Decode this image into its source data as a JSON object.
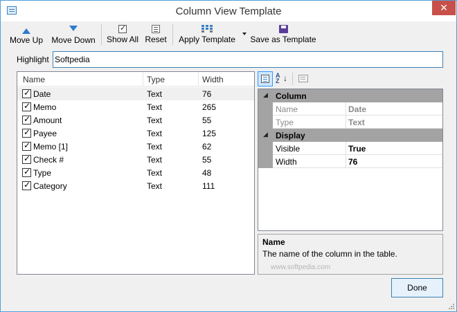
{
  "window": {
    "title": "Column View Template",
    "close_glyph": "✕"
  },
  "toolbar": {
    "move_up_label": "Move Up",
    "move_down_label": "Move Down",
    "show_all_label": "Show All",
    "reset_label": "Reset",
    "apply_template_label": "Apply Template",
    "save_as_template_label": "Save as Template"
  },
  "highlight": {
    "label": "Highlight",
    "value": "Softpedia"
  },
  "columns_list": {
    "headers": [
      "Name",
      "Type",
      "Width"
    ],
    "rows": [
      {
        "checked": true,
        "name": "Date",
        "type": "Text",
        "width": "76",
        "selected": true
      },
      {
        "checked": true,
        "name": "Memo",
        "type": "Text",
        "width": "265"
      },
      {
        "checked": true,
        "name": "Amount",
        "type": "Text",
        "width": "55"
      },
      {
        "checked": true,
        "name": "Payee",
        "type": "Text",
        "width": "125"
      },
      {
        "checked": true,
        "name": "Memo [1]",
        "type": "Text",
        "width": "62"
      },
      {
        "checked": true,
        "name": "Check #",
        "type": "Text",
        "width": "55"
      },
      {
        "checked": true,
        "name": "Type",
        "type": "Text",
        "width": "48"
      },
      {
        "checked": true,
        "name": "Category",
        "type": "Text",
        "width": "111"
      }
    ]
  },
  "property_grid": {
    "categories": [
      {
        "name": "Column",
        "toggle": "◢",
        "properties": [
          {
            "name": "Name",
            "value": "Date",
            "disabled": true
          },
          {
            "name": "Type",
            "value": "Text",
            "disabled": true
          }
        ]
      },
      {
        "name": "Display",
        "toggle": "◢",
        "properties": [
          {
            "name": "Visible",
            "value": "True",
            "disabled": false
          },
          {
            "name": "Width",
            "value": "76",
            "disabled": false
          }
        ]
      }
    ],
    "az_glyph": "A\nZ",
    "sort_arrow": "↓"
  },
  "help": {
    "title": "Name",
    "description": "The  name of the column in the table."
  },
  "watermark": "www.softpedia.com",
  "done_label": "Done",
  "colors": {
    "accent": "#3c7fb1",
    "close": "#c7504a",
    "selected_row": "#f0f0f0",
    "category_band": "#a3a3a3"
  }
}
